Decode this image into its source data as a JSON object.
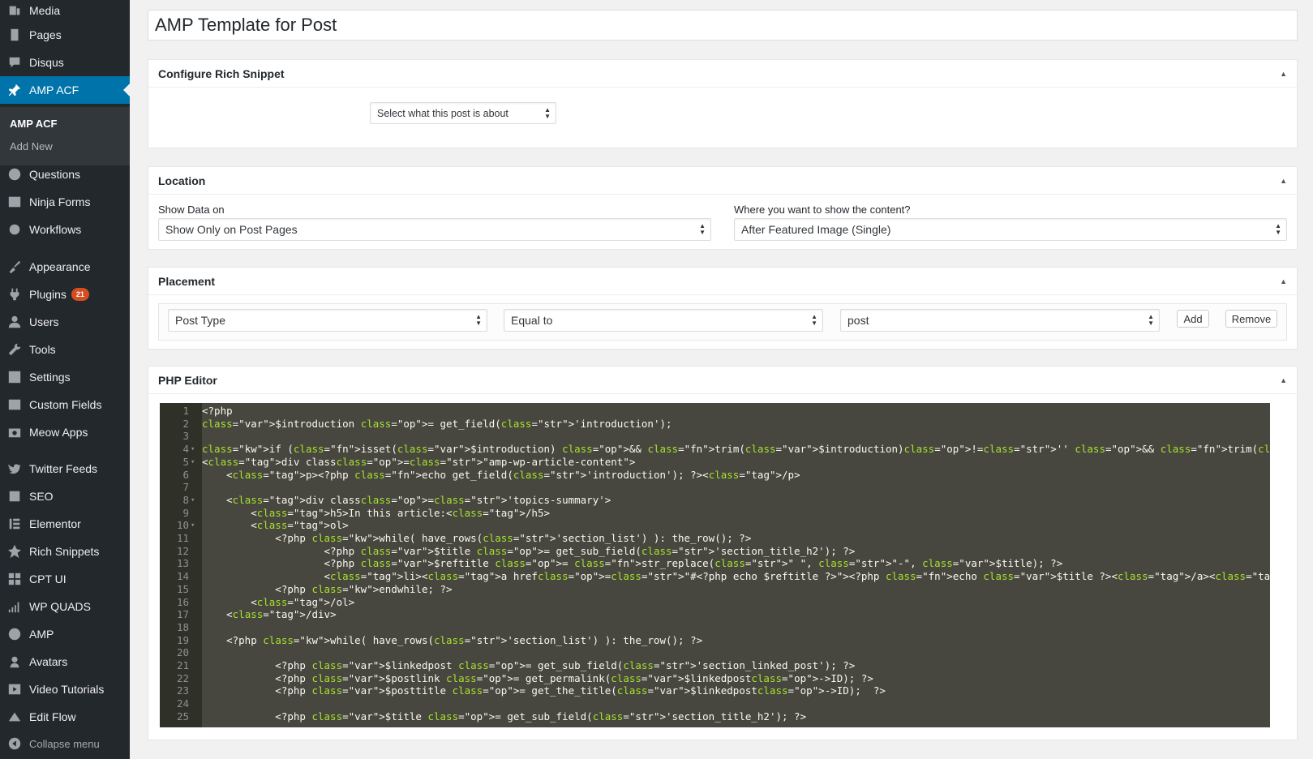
{
  "sidebar": {
    "items": [
      {
        "label": "Media",
        "icon": "media-icon"
      },
      {
        "label": "Pages",
        "icon": "pages-icon"
      },
      {
        "label": "Disqus",
        "icon": "comment-icon"
      },
      {
        "label": "AMP ACF",
        "icon": "pin-icon",
        "current": true
      },
      {
        "label": "Questions",
        "icon": "question-icon"
      },
      {
        "label": "Ninja Forms",
        "icon": "forms-icon"
      },
      {
        "label": "Workflows",
        "icon": "gear-icon"
      },
      {
        "label": "Appearance",
        "icon": "brush-icon"
      },
      {
        "label": "Plugins",
        "icon": "plugin-icon",
        "badge": "21"
      },
      {
        "label": "Users",
        "icon": "user-icon"
      },
      {
        "label": "Tools",
        "icon": "wrench-icon"
      },
      {
        "label": "Settings",
        "icon": "settings-icon"
      },
      {
        "label": "Custom Fields",
        "icon": "table-icon"
      },
      {
        "label": "Meow Apps",
        "icon": "camera-icon"
      },
      {
        "label": "Twitter Feeds",
        "icon": "twitter-icon"
      },
      {
        "label": "SEO",
        "icon": "seo-icon"
      },
      {
        "label": "Elementor",
        "icon": "elementor-icon"
      },
      {
        "label": "Rich Snippets",
        "icon": "star-icon"
      },
      {
        "label": "CPT UI",
        "icon": "grid-icon"
      },
      {
        "label": "WP QUADS",
        "icon": "bars-icon"
      },
      {
        "label": "AMP",
        "icon": "amp-icon"
      },
      {
        "label": "Avatars",
        "icon": "avatar-icon"
      },
      {
        "label": "Video Tutorials",
        "icon": "video-icon"
      },
      {
        "label": "Edit Flow",
        "icon": "flow-icon"
      }
    ],
    "submenu": {
      "head": "AMP ACF",
      "add_new": "Add New"
    },
    "collapse_label": "Collapse menu"
  },
  "title_value": "AMP Template for Post",
  "rich_snippet": {
    "heading": "Configure Rich Snippet",
    "select_value": "Select what this post is about"
  },
  "location": {
    "heading": "Location",
    "show_label": "Show Data on",
    "show_value": "Show Only on Post Pages",
    "where_label": "Where you want to show the content?",
    "where_value": "After Featured Image (Single)"
  },
  "placement": {
    "heading": "Placement",
    "param": "Post Type",
    "operator": "Equal to",
    "value": "post",
    "add_label": "Add",
    "remove_label": "Remove"
  },
  "php_editor": {
    "heading": "PHP Editor",
    "lines": [
      "<?php",
      "$introduction = get_field('introduction');",
      "",
      "if (isset($introduction) && trim($introduction)!='' && trim($introduction)!='<p></p>')  {?>",
      "<div class=\"amp-wp-article-content\">",
      "    <p><?php echo get_field('introduction'); ?></p>",
      "",
      "    <div class='topics-summary'>",
      "        <h5>In this article:</h5>",
      "        <ol>",
      "            <?php while( have_rows('section_list') ): the_row(); ?>",
      "                    <?php $title = get_sub_field('section_title_h2'); ?>",
      "                    <?php $reftitle = str_replace(\" \", \"-\", $title); ?>",
      "                    <li><a href=\"#<?php echo $reftitle ?>\"><?php echo $title ?></a></li>",
      "            <?php endwhile; ?>",
      "        </ol>",
      "    </div>",
      "",
      "    <?php while( have_rows('section_list') ): the_row(); ?>",
      "",
      "            <?php $linkedpost = get_sub_field('section_linked_post'); ?>",
      "            <?php $postlink = get_permalink($linkedpost->ID); ?>",
      "            <?php $posttitle = get_the_title($linkedpost->ID);  ?>",
      "",
      "            <?php $title = get_sub_field('section_title_h2'); ?>"
    ],
    "fold_lines": [
      4,
      5,
      8,
      10
    ]
  }
}
